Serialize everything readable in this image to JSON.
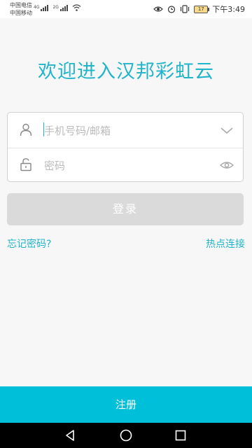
{
  "status_bar": {
    "carrier_1": "中国电信",
    "carrier_2": "中国移动",
    "net_1": "4G",
    "net_2": "2G",
    "battery": "17",
    "time": "下午3:49"
  },
  "welcome_title": "欢迎进入汉邦彩虹云",
  "login_form": {
    "account_placeholder": "手机号码/邮箱",
    "password_placeholder": "密码"
  },
  "login_button": "登录",
  "forgot_password": "忘记密码?",
  "hotspot_connect": "热点连接",
  "register_button": "注册",
  "colors": {
    "accent": "#22b4c9",
    "register_bg": "#00bfd8",
    "login_disabled": "#dadada"
  }
}
